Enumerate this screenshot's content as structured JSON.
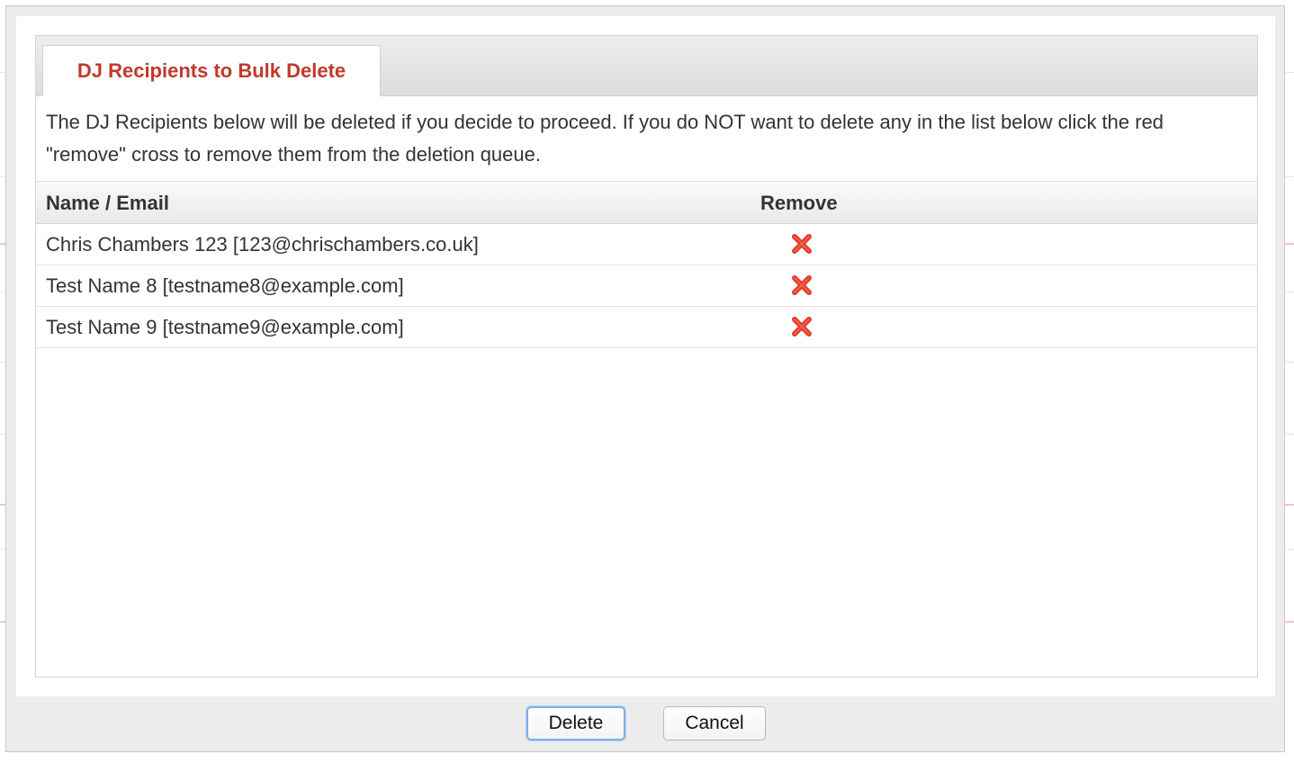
{
  "dialog": {
    "tab_title": "DJ Recipients to Bulk Delete",
    "intro_text": "The DJ Recipients below will be deleted if you decide to proceed. If you do NOT want to delete any in the list below click the red \"remove\" cross to remove them from the deletion queue.",
    "table": {
      "headers": {
        "name_email": "Name / Email",
        "remove": "Remove"
      },
      "rows": [
        {
          "name_email": "Chris Chambers 123 [123@chrischambers.co.uk]",
          "remove_icon": "red-cross-icon"
        },
        {
          "name_email": "Test Name 8 [testname8@example.com]",
          "remove_icon": "red-cross-icon"
        },
        {
          "name_email": "Test Name 9 [testname9@example.com]",
          "remove_icon": "red-cross-icon"
        }
      ]
    },
    "buttons": {
      "delete_label": "Delete",
      "cancel_label": "Cancel"
    }
  },
  "colors": {
    "accent": "#c0392b",
    "cross": "#e03a2a",
    "focus": "#7fb0e6"
  }
}
